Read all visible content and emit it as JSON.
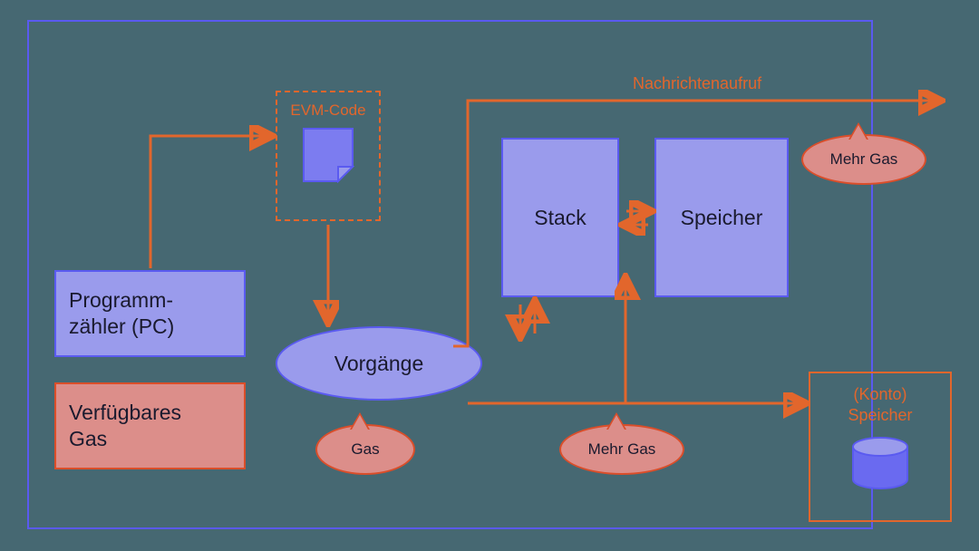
{
  "boxes": {
    "programm_zaehler": "Programm-\nzähler (PC)",
    "verfuegbares_gas": "Verfügbares\nGas",
    "evm_code": "EVM-Code",
    "vorgaenge": "Vorgänge",
    "stack": "Stack",
    "speicher": "Speicher"
  },
  "bubbles": {
    "gas": "Gas",
    "mehr_gas": "Mehr Gas"
  },
  "konto": {
    "line1": "(Konto)",
    "line2": "Speicher"
  },
  "labels": {
    "nachrichtenaufruf": "Nachrichtenaufruf"
  },
  "colors": {
    "accent_purple": "#9a9bec",
    "border_purple": "#5a5af0",
    "accent_orange": "#e2662c",
    "bubble_fill": "#dc8e8a",
    "bubble_border": "#da4e2a",
    "background": "#466872"
  }
}
